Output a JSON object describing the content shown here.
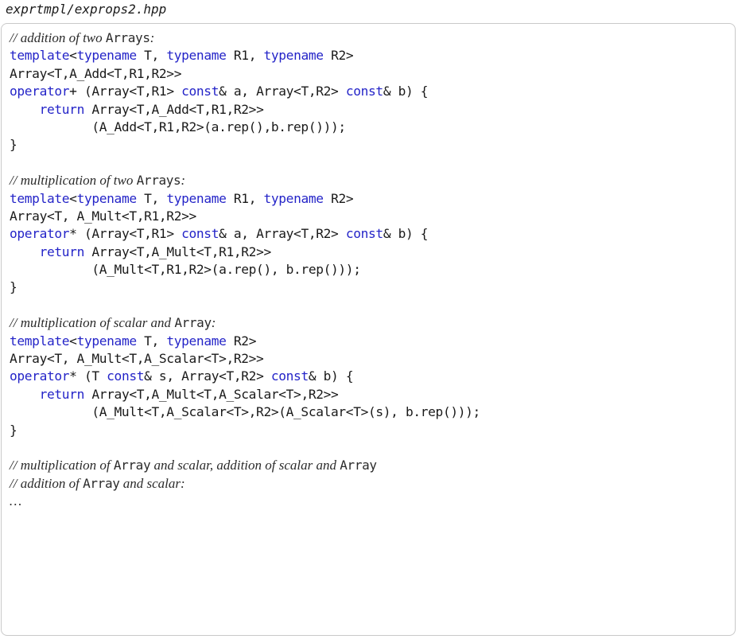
{
  "filename": "exprtmpl/exprops2.hpp",
  "code_lines": [
    [
      {
        "t": "// addition of two ",
        "k": "comment"
      },
      {
        "t": "Arrays",
        "k": "commentcode"
      },
      {
        "t": ":",
        "k": "comment"
      }
    ],
    [
      {
        "t": "template",
        "k": "kw"
      },
      {
        "t": "<",
        "k": "plain"
      },
      {
        "t": "typename",
        "k": "kw"
      },
      {
        "t": " T, ",
        "k": "plain"
      },
      {
        "t": "typename",
        "k": "kw"
      },
      {
        "t": " R1, ",
        "k": "plain"
      },
      {
        "t": "typename",
        "k": "kw"
      },
      {
        "t": " R2>",
        "k": "plain"
      }
    ],
    [
      {
        "t": "Array<T,A_Add<T,R1,R2>>",
        "k": "plain"
      }
    ],
    [
      {
        "t": "operator",
        "k": "kw"
      },
      {
        "t": "+ (Array<T,R1> ",
        "k": "plain"
      },
      {
        "t": "const",
        "k": "kw"
      },
      {
        "t": "& a, Array<T,R2> ",
        "k": "plain"
      },
      {
        "t": "const",
        "k": "kw"
      },
      {
        "t": "& b) {",
        "k": "plain"
      }
    ],
    [
      {
        "t": "    ",
        "k": "plain"
      },
      {
        "t": "return",
        "k": "kw"
      },
      {
        "t": " Array<T,A_Add<T,R1,R2>>",
        "k": "plain"
      }
    ],
    [
      {
        "t": "           (A_Add<T,R1,R2>(a.rep(),b.rep()));",
        "k": "plain"
      }
    ],
    [
      {
        "t": "}",
        "k": "plain"
      }
    ],
    [],
    [
      {
        "t": "// multiplication of two ",
        "k": "comment"
      },
      {
        "t": "Arrays",
        "k": "commentcode"
      },
      {
        "t": ":",
        "k": "comment"
      }
    ],
    [
      {
        "t": "template",
        "k": "kw"
      },
      {
        "t": "<",
        "k": "plain"
      },
      {
        "t": "typename",
        "k": "kw"
      },
      {
        "t": " T, ",
        "k": "plain"
      },
      {
        "t": "typename",
        "k": "kw"
      },
      {
        "t": " R1, ",
        "k": "plain"
      },
      {
        "t": "typename",
        "k": "kw"
      },
      {
        "t": " R2>",
        "k": "plain"
      }
    ],
    [
      {
        "t": "Array<T, A_Mult<T,R1,R2>>",
        "k": "plain"
      }
    ],
    [
      {
        "t": "operator",
        "k": "kw"
      },
      {
        "t": "* (Array<T,R1> ",
        "k": "plain"
      },
      {
        "t": "const",
        "k": "kw"
      },
      {
        "t": "& a, Array<T,R2> ",
        "k": "plain"
      },
      {
        "t": "const",
        "k": "kw"
      },
      {
        "t": "& b) {",
        "k": "plain"
      }
    ],
    [
      {
        "t": "    ",
        "k": "plain"
      },
      {
        "t": "return",
        "k": "kw"
      },
      {
        "t": " Array<T,A_Mult<T,R1,R2>>",
        "k": "plain"
      }
    ],
    [
      {
        "t": "           (A_Mult<T,R1,R2>(a.rep(), b.rep()));",
        "k": "plain"
      }
    ],
    [
      {
        "t": "}",
        "k": "plain"
      }
    ],
    [],
    [
      {
        "t": "// multiplication of scalar and ",
        "k": "comment"
      },
      {
        "t": "Array",
        "k": "commentcode"
      },
      {
        "t": ":",
        "k": "comment"
      }
    ],
    [
      {
        "t": "template",
        "k": "kw"
      },
      {
        "t": "<",
        "k": "plain"
      },
      {
        "t": "typename",
        "k": "kw"
      },
      {
        "t": " T, ",
        "k": "plain"
      },
      {
        "t": "typename",
        "k": "kw"
      },
      {
        "t": " R2>",
        "k": "plain"
      }
    ],
    [
      {
        "t": "Array<T, A_Mult<T,A_Scalar<T>,R2>>",
        "k": "plain"
      }
    ],
    [
      {
        "t": "operator",
        "k": "kw"
      },
      {
        "t": "* (T ",
        "k": "plain"
      },
      {
        "t": "const",
        "k": "kw"
      },
      {
        "t": "& s, Array<T,R2> ",
        "k": "plain"
      },
      {
        "t": "const",
        "k": "kw"
      },
      {
        "t": "& b) {",
        "k": "plain"
      }
    ],
    [
      {
        "t": "    ",
        "k": "plain"
      },
      {
        "t": "return",
        "k": "kw"
      },
      {
        "t": " Array<T,A_Mult<T,A_Scalar<T>,R2>>",
        "k": "plain"
      }
    ],
    [
      {
        "t": "           (A_Mult<T,A_Scalar<T>,R2>(A_Scalar<T>(s), b.rep()));",
        "k": "plain"
      }
    ],
    [
      {
        "t": "}",
        "k": "plain"
      }
    ],
    [],
    [
      {
        "t": "// multiplication of ",
        "k": "comment"
      },
      {
        "t": "Array",
        "k": "commentcode"
      },
      {
        "t": " and scalar, addition of scalar and ",
        "k": "comment"
      },
      {
        "t": "Array",
        "k": "commentcode"
      }
    ],
    [
      {
        "t": "// addition of ",
        "k": "comment"
      },
      {
        "t": "Array",
        "k": "commentcode"
      },
      {
        "t": " and scalar:",
        "k": "comment"
      }
    ],
    [
      {
        "t": "…",
        "k": "comment"
      }
    ]
  ],
  "colors": {
    "keyword": "#2424c8",
    "text": "#1a1a1a",
    "border": "#c9c9c9",
    "background": "#ffffff"
  }
}
